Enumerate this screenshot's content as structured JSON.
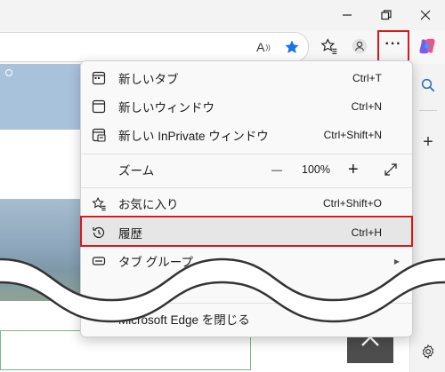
{
  "menu": {
    "items": {
      "new_tab": {
        "label": "新しいタブ",
        "shortcut": "Ctrl+T"
      },
      "new_window": {
        "label": "新しいウィンドウ",
        "shortcut": "Ctrl+N"
      },
      "new_inprivate": {
        "label": "新しい InPrivate ウィンドウ",
        "shortcut": "Ctrl+Shift+N"
      },
      "zoom": {
        "label": "ズーム",
        "minus": "—",
        "value": "100%",
        "plus": "+"
      },
      "favorites": {
        "label": "お気に入り",
        "shortcut": "Ctrl+Shift+O"
      },
      "history": {
        "label": "履歴",
        "shortcut": "Ctrl+H"
      },
      "tab_groups": {
        "label": "タブ グループ"
      },
      "close_edge": {
        "label": "Microsoft Edge を閉じる"
      }
    }
  },
  "toolbar": {
    "read_aloud": "A",
    "more": "···"
  },
  "sidebar": {
    "add": "+"
  },
  "colors": {
    "highlight": "#d8191c",
    "favorite_star": "#1a73e8"
  }
}
